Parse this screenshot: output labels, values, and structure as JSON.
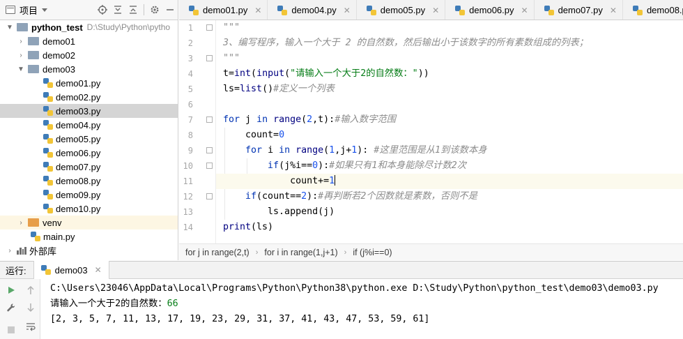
{
  "project_panel": {
    "title": "项目",
    "toolbar_icons": [
      "crosshair-icon",
      "expand-all-icon",
      "collapse-all-icon",
      "gear-icon",
      "minimize-icon"
    ],
    "tree": [
      {
        "label": "python_test",
        "path": "D:\\Study\\Python\\pytho",
        "kind": "root-folder",
        "expanded": true
      },
      {
        "label": "demo01",
        "kind": "folder",
        "expanded": false
      },
      {
        "label": "demo02",
        "kind": "folder",
        "expanded": false
      },
      {
        "label": "demo03",
        "kind": "folder",
        "expanded": true
      },
      {
        "label": "demo01.py",
        "kind": "file"
      },
      {
        "label": "demo02.py",
        "kind": "file"
      },
      {
        "label": "demo03.py",
        "kind": "file",
        "selected": true
      },
      {
        "label": "demo04.py",
        "kind": "file"
      },
      {
        "label": "demo05.py",
        "kind": "file"
      },
      {
        "label": "demo06.py",
        "kind": "file"
      },
      {
        "label": "demo07.py",
        "kind": "file"
      },
      {
        "label": "demo08.py",
        "kind": "file"
      },
      {
        "label": "demo09.py",
        "kind": "file"
      },
      {
        "label": "demo10.py",
        "kind": "file"
      },
      {
        "label": "venv",
        "kind": "venv-folder",
        "expanded": false
      },
      {
        "label": "main.py",
        "kind": "file"
      },
      {
        "label": "外部库",
        "kind": "library",
        "expanded": false
      }
    ]
  },
  "editor_tabs": [
    "demo01.py",
    "demo04.py",
    "demo05.py",
    "demo06.py",
    "demo07.py",
    "demo08.py",
    "de"
  ],
  "editor": {
    "line_numbers": [
      "1",
      "2",
      "3",
      "4",
      "5",
      "6",
      "7",
      "8",
      "9",
      "10",
      "11",
      "12",
      "13",
      "14"
    ],
    "current_line": 11
  },
  "breadcrumb": [
    "for j in range(2,t)",
    "for i in range(1,j+1)",
    "if (j%i==0)"
  ],
  "run_panel": {
    "label": "运行:",
    "tab": "demo03",
    "console": {
      "command": "C:\\Users\\23046\\AppData\\Local\\Programs\\Python\\Python38\\python.exe D:\\Study\\Python\\python_test\\demo03\\demo03.py",
      "prompt": "请输入一个大于2的自然数：",
      "input": "66",
      "output": "[2, 3, 5, 7, 11, 13, 17, 19, 23, 29, 31, 37, 41, 43, 47, 53, 59, 61]"
    }
  },
  "colors": {
    "keyword": "#0033b3",
    "string": "#067d17",
    "number": "#1750eb",
    "comment": "#8c8c8c",
    "selection": "#d5d5d5",
    "current_line": "#fcfaed",
    "run_icon": "#59a869"
  }
}
